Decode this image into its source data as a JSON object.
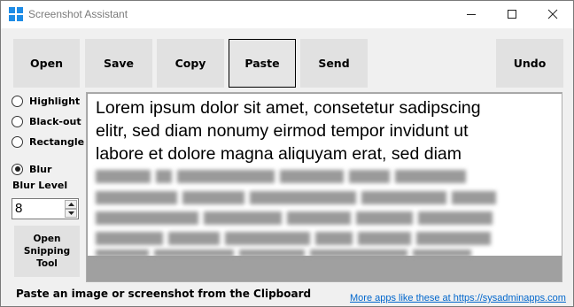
{
  "window": {
    "title": "Screenshot Assistant"
  },
  "toolbar": {
    "open_label": "Open",
    "save_label": "Save",
    "copy_label": "Copy",
    "paste_label": "Paste",
    "send_label": "Send",
    "undo_label": "Undo"
  },
  "tools": {
    "highlight_label": "Highlight",
    "blackout_label": "Black-out",
    "rectangle_label": "Rectangle",
    "blur_label": "Blur",
    "selected": "Blur",
    "blur_level_label": "Blur Level",
    "blur_level_value": "8",
    "snipping_label": "Open\nSnipping\nTool"
  },
  "canvas": {
    "lines": [
      "Lorem ipsum dolor sit amet, consetetur sadipscing",
      "elitr, sed diam nonumy eirmod tempor invidunt ut",
      "labore et dolore magna aliquyam erat, sed diam"
    ],
    "blurred_line_count": 5
  },
  "status": {
    "message": "Paste an image or screenshot from the Clipboard",
    "link_text": "More apps like these at https://sysadminapps.com"
  },
  "colors": {
    "accent": "#1e8ce6",
    "link": "#0066cc",
    "button_face": "#e1e1e1",
    "canvas_bg": "#a0a0a0"
  }
}
